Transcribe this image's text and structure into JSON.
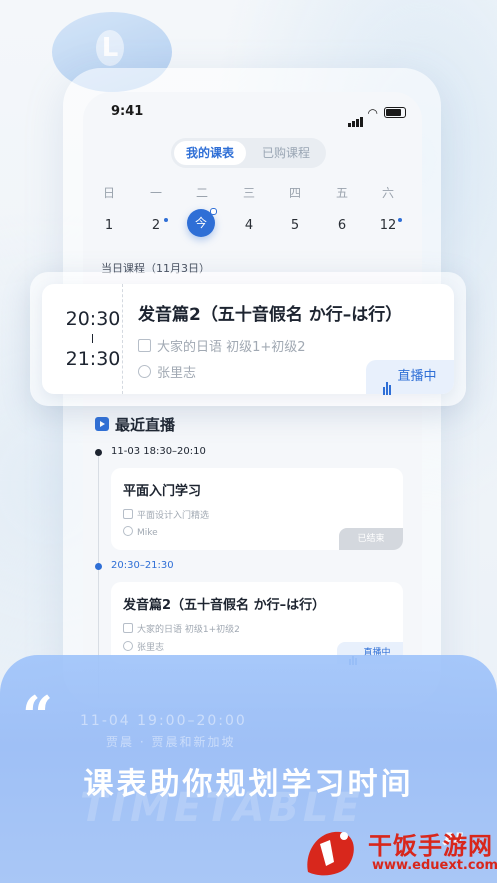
{
  "status_bar": {
    "time": "9:41"
  },
  "segment": {
    "tabs": [
      "我的课表",
      "已购课程"
    ],
    "active": 0
  },
  "week": {
    "days": [
      "日",
      "一",
      "二",
      "三",
      "四",
      "五",
      "六"
    ],
    "dates": [
      "1",
      "2",
      "今",
      "4",
      "5",
      "6",
      "12"
    ],
    "today_index": 2,
    "dot_indices": [
      1,
      6
    ]
  },
  "day_label": "当日课程（11月3日）",
  "featured": {
    "start": "20:30",
    "end": "21:30",
    "title": "发音篇2（五十音假名 か行–は行）",
    "course": "大家的日语 初级1+初级2",
    "teacher": "张里志",
    "badge": "直播中"
  },
  "recent": {
    "title": "最近直播",
    "items": [
      {
        "time": "11-03 18:30–20:10",
        "title": "平面入门学习",
        "course": "平面设计入门精选",
        "teacher": "Mike",
        "badge": "已结束"
      },
      {
        "time": "20:30–21:30",
        "title": "发音篇2（五十音假名 か行–は行）",
        "course": "大家的日语 初级1+初级2",
        "teacher": "张里志",
        "badge": "直播中"
      }
    ],
    "faded_time": "11-04 19:00–20:00",
    "faded_title": "贾晨 · 贾晨和新加坡"
  },
  "promo": {
    "quote_mark": "“",
    "slogan": "课表助你规划学习时间",
    "bg_word": "TIMETABLE",
    "quote_mark_end": "”"
  },
  "watermark": {
    "title": "干饭手游网",
    "url": "www.eduext.com"
  },
  "colors": {
    "accent": "#2f6fd6",
    "promo": "#a0c2f7",
    "watermark": "#d8271c"
  }
}
